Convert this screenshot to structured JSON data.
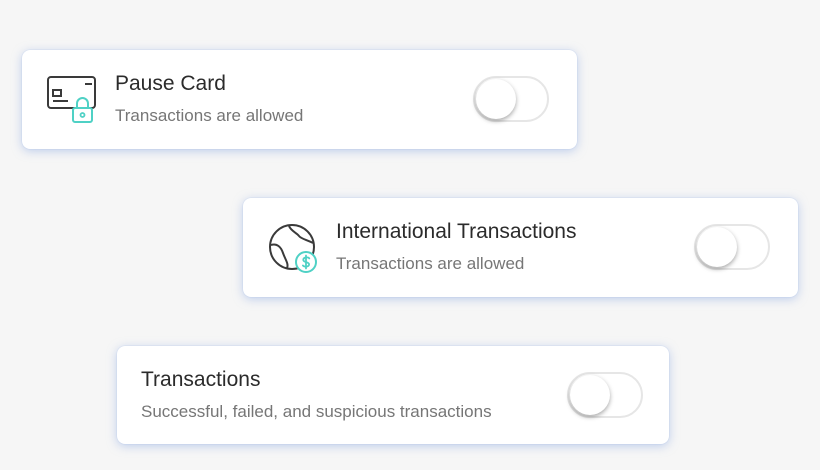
{
  "settings": [
    {
      "title": "Pause Card",
      "subtitle": "Transactions are allowed",
      "icon": "card-lock-icon",
      "enabled": false
    },
    {
      "title": "International Transactions",
      "subtitle": "Transactions are allowed",
      "icon": "globe-dollar-icon",
      "enabled": false
    },
    {
      "title": "Transactions",
      "subtitle": "Successful, failed, and suspicious transactions",
      "enabled": false
    }
  ],
  "colors": {
    "accent": "#4fd1c5",
    "icon_stroke": "#3a3a3a",
    "title": "#2b2b2b",
    "subtitle": "#767676",
    "card_shadow": "#8caae1",
    "background": "#f6f6f6"
  }
}
